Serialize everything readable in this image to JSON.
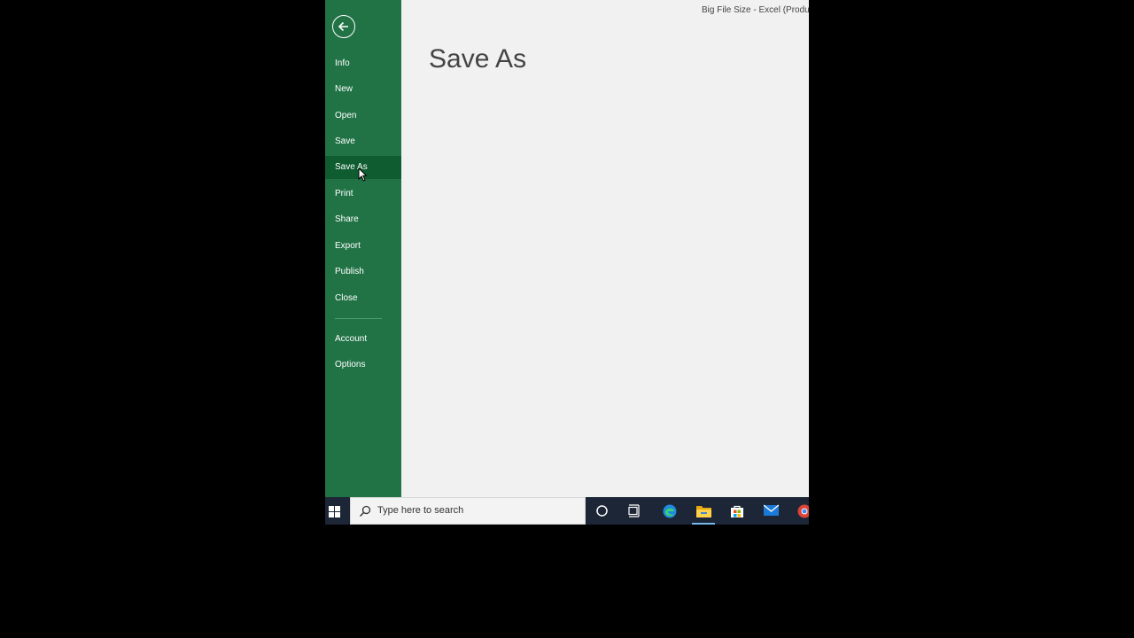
{
  "window": {
    "title": "Big File Size - Excel (Product A"
  },
  "backstage": {
    "nav_top": [
      "Info",
      "New",
      "Open",
      "Save",
      "Save As",
      "Print",
      "Share",
      "Export",
      "Publish",
      "Close"
    ],
    "nav_bottom": [
      "Account",
      "Options"
    ],
    "active_item": "Save As",
    "accent_color": "#217346",
    "active_color": "#0e5c30"
  },
  "main": {
    "title": "Save As"
  },
  "taskbar": {
    "search_placeholder": "Type here to search",
    "icons": [
      "windows-start-icon",
      "cortana-icon",
      "task-view-icon",
      "edge-icon",
      "file-explorer-icon",
      "store-icon",
      "mail-icon",
      "chrome-icon"
    ],
    "active_app": "file-explorer-icon"
  }
}
